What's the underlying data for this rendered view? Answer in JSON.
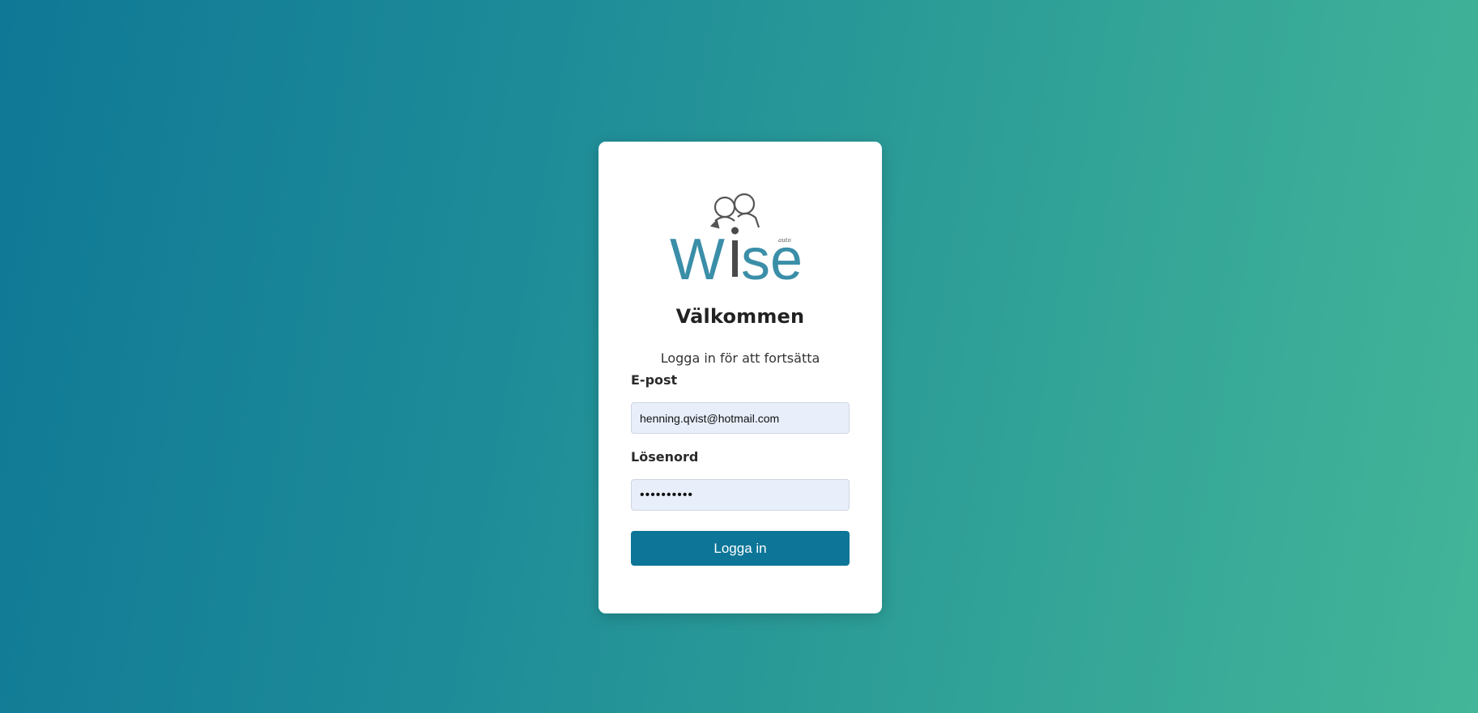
{
  "logo": {
    "text": "Wise",
    "small_text": "auto",
    "colors": {
      "primary": "#3a8ea8",
      "accent": "#4a4a4a"
    }
  },
  "login": {
    "title": "Välkommen",
    "subtitle": "Logga in för att fortsätta",
    "email_label": "E-post",
    "email_value": "henning.qvist@hotmail.com",
    "password_label": "Lösenord",
    "password_value": "••••••••••",
    "submit_label": "Logga in"
  },
  "colors": {
    "background_start": "#0f7896",
    "background_end": "#43b598",
    "button": "#0d7698",
    "input_background": "#e8effb"
  }
}
